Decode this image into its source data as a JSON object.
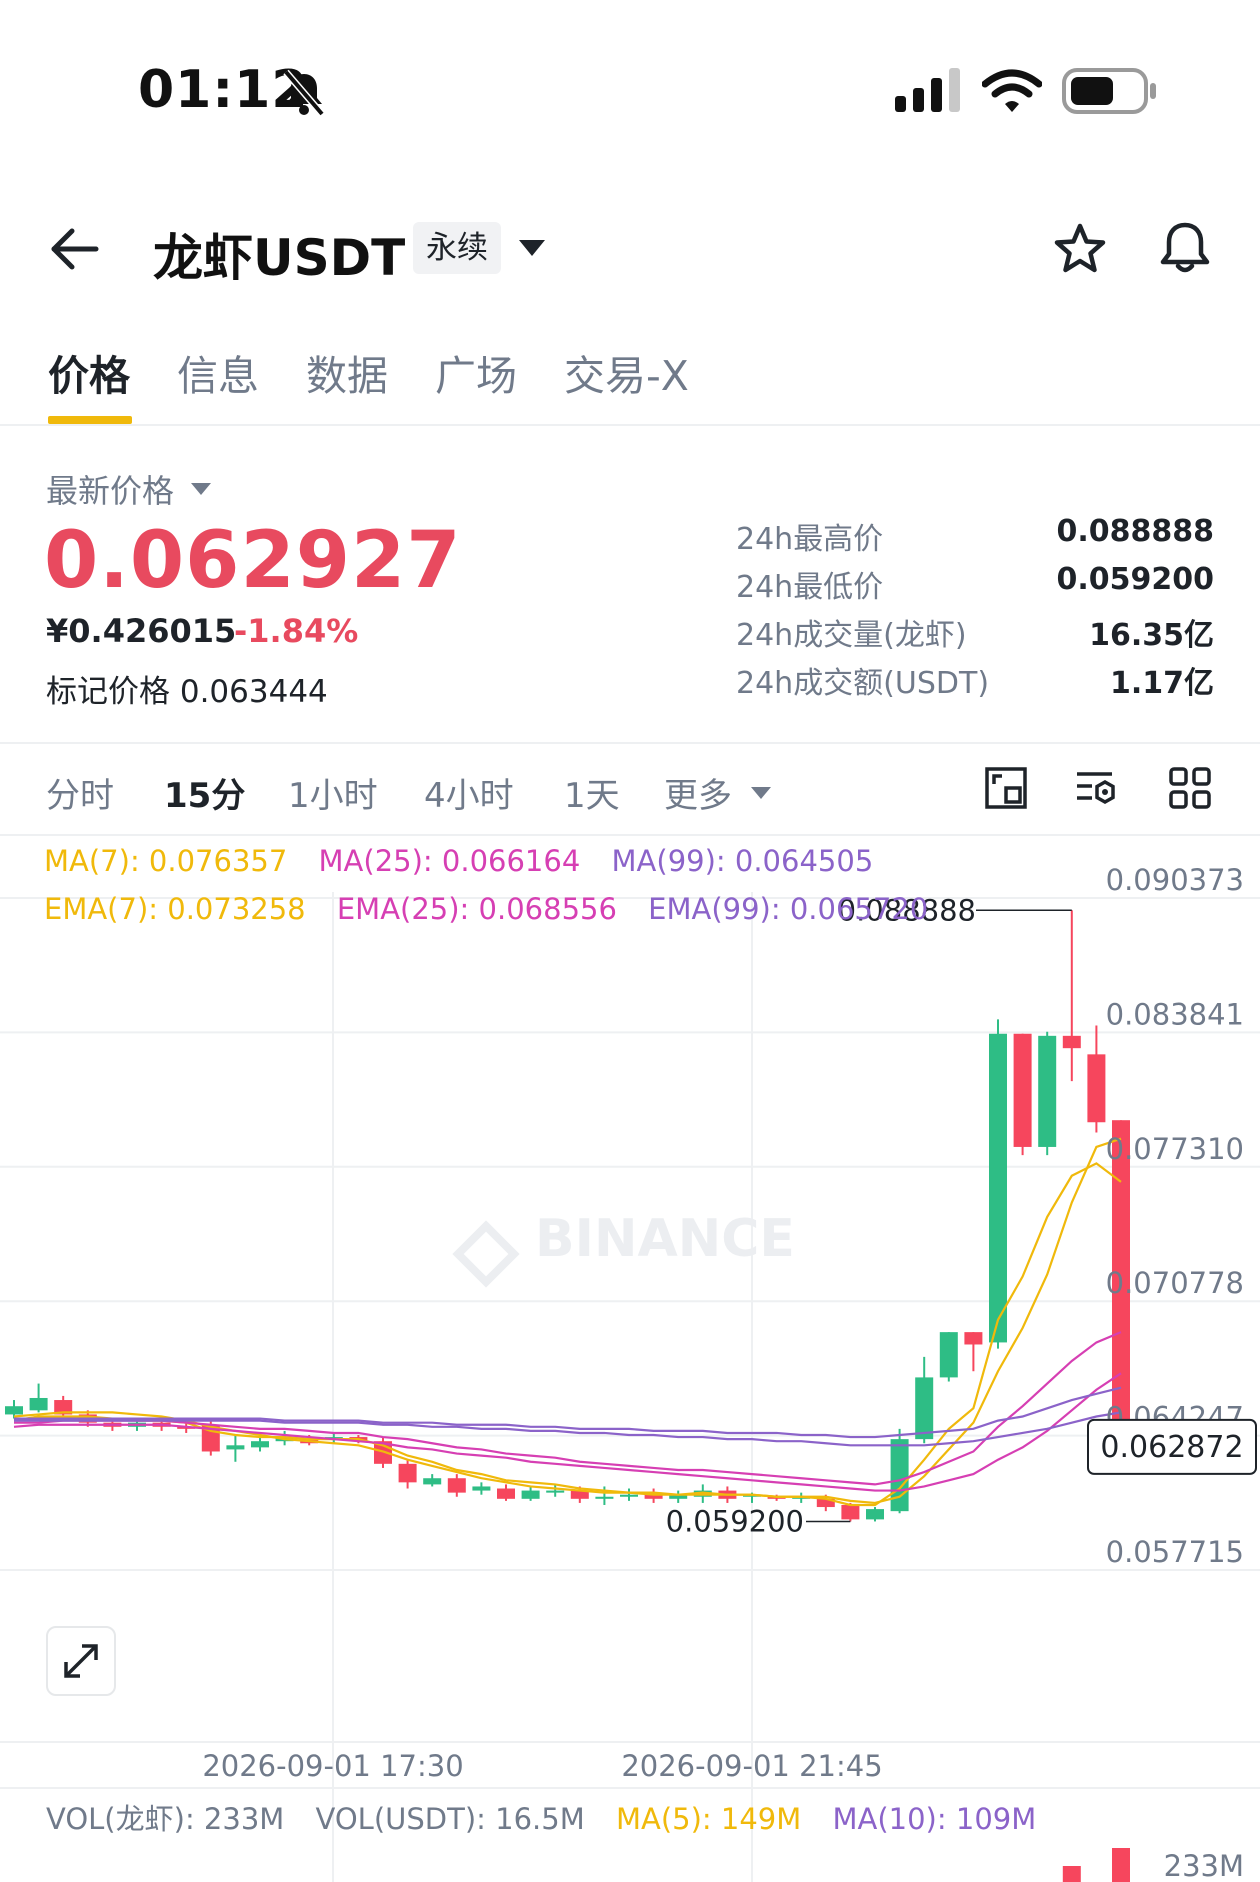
{
  "status_bar": {
    "time": "01:12",
    "icons": [
      "silent-bell-icon",
      "signal-icon",
      "wifi-icon",
      "battery-icon"
    ]
  },
  "header": {
    "pair": "龙虾USDT",
    "badge": "永续",
    "icons": [
      "back-arrow-icon",
      "dropdown-icon",
      "star-icon",
      "bell-icon"
    ]
  },
  "tabs": [
    "价格",
    "信息",
    "数据",
    "广场",
    "交易-X"
  ],
  "summary": {
    "latest_label": "最新价格",
    "last_price": "0.062927",
    "cny_price": "¥0.426015",
    "change_pct": "-1.84%",
    "mark_label": "标记价格",
    "mark_price": "0.063444",
    "stats": [
      {
        "label": "24h最高价",
        "value": "0.088888"
      },
      {
        "label": "24h最低价",
        "value": "0.059200"
      },
      {
        "label": "24h成交量(龙虾)",
        "value": "16.35亿"
      },
      {
        "label": "24h成交额(USDT)",
        "value": "1.17亿"
      }
    ]
  },
  "intervals": {
    "items": [
      "分时",
      "15分",
      "1小时",
      "4小时",
      "1天",
      "更多"
    ],
    "active": "15分"
  },
  "chart_tools": [
    "fullscreen-icon",
    "indicator-settings-icon",
    "grid-layout-icon"
  ],
  "indicators": {
    "ma7": "MA(7): 0.076357",
    "ma25": "MA(25): 0.066164",
    "ma99": "MA(99): 0.064505",
    "ema7": "EMA(7): 0.073258",
    "ema25": "EMA(25): 0.068556",
    "ema99": "EMA(99): 0.065720"
  },
  "volume": {
    "vol_coin": "VOL(龙虾): 233M",
    "vol_usdt": "VOL(USDT): 16.5M",
    "ma5": "MA(5): 149M",
    "ma10": "MA(10): 109M",
    "axis_top": "233M"
  },
  "colors": {
    "up": "#2ebd85",
    "down": "#f6465d",
    "ma7": "#f0b90b",
    "ma25": "#d63fb3",
    "ma99": "#8b63c9",
    "accent": "#f0b90b"
  },
  "watermark": "BINANCE",
  "chart_data": {
    "type": "candlestick",
    "price_axis": [
      "0.090373",
      "0.083841",
      "0.077310",
      "0.070778",
      "0.064247",
      "0.057715"
    ],
    "current_price_label": "0.062872",
    "high_label": "0.088888",
    "low_label": "0.059200",
    "x_ticks": [
      "2026-09-01 17:30",
      "2026-09-01 21:45"
    ],
    "ylim": [
      0.0572,
      0.0918
    ],
    "candles": [
      [
        0.0644,
        0.0648,
        0.0642,
        0.0651
      ],
      [
        0.0646,
        0.0652,
        0.0645,
        0.0659
      ],
      [
        0.0651,
        0.0644,
        0.0642,
        0.0653
      ],
      [
        0.0644,
        0.064,
        0.0638,
        0.0646
      ],
      [
        0.064,
        0.0638,
        0.0636,
        0.0642
      ],
      [
        0.0638,
        0.064,
        0.0636,
        0.0642
      ],
      [
        0.064,
        0.0638,
        0.0636,
        0.0642
      ],
      [
        0.0638,
        0.0637,
        0.0635,
        0.064
      ],
      [
        0.0639,
        0.0626,
        0.0624,
        0.0641
      ],
      [
        0.0627,
        0.0629,
        0.0621,
        0.0634
      ],
      [
        0.0628,
        0.0631,
        0.0626,
        0.0634
      ],
      [
        0.0631,
        0.0633,
        0.0629,
        0.0636
      ],
      [
        0.0632,
        0.063,
        0.0629,
        0.0634
      ],
      [
        0.0632,
        0.0633,
        0.063,
        0.0635
      ],
      [
        0.0633,
        0.0631,
        0.063,
        0.0634
      ],
      [
        0.0631,
        0.062,
        0.0618,
        0.0633
      ],
      [
        0.062,
        0.0611,
        0.0608,
        0.0622
      ],
      [
        0.061,
        0.0613,
        0.0609,
        0.0615
      ],
      [
        0.0613,
        0.0606,
        0.0604,
        0.0615
      ],
      [
        0.0607,
        0.0609,
        0.0605,
        0.0611
      ],
      [
        0.0608,
        0.0603,
        0.0602,
        0.061
      ],
      [
        0.0603,
        0.0607,
        0.0602,
        0.0609
      ],
      [
        0.0606,
        0.0607,
        0.0604,
        0.061
      ],
      [
        0.0607,
        0.0603,
        0.0601,
        0.0609
      ],
      [
        0.0603,
        0.0604,
        0.06,
        0.0609
      ],
      [
        0.0604,
        0.0605,
        0.0602,
        0.0608
      ],
      [
        0.0605,
        0.0603,
        0.0601,
        0.0608
      ],
      [
        0.0603,
        0.0605,
        0.0601,
        0.0607
      ],
      [
        0.0604,
        0.0607,
        0.0601,
        0.061
      ],
      [
        0.0607,
        0.0603,
        0.0601,
        0.0609
      ],
      [
        0.0604,
        0.0605,
        0.0601,
        0.0606
      ],
      [
        0.0604,
        0.0603,
        0.0602,
        0.0605
      ],
      [
        0.0603,
        0.0604,
        0.0601,
        0.0606
      ],
      [
        0.0603,
        0.0599,
        0.0597,
        0.0605
      ],
      [
        0.06,
        0.0593,
        0.0592,
        0.0601
      ],
      [
        0.0593,
        0.0598,
        0.0592,
        0.0599
      ],
      [
        0.0597,
        0.0632,
        0.0596,
        0.0637
      ],
      [
        0.0632,
        0.0662,
        0.063,
        0.0672
      ],
      [
        0.0662,
        0.0684,
        0.066,
        0.0684
      ],
      [
        0.0684,
        0.0678,
        0.0665,
        0.0684
      ],
      [
        0.0679,
        0.0829,
        0.0676,
        0.0836
      ],
      [
        0.0829,
        0.0774,
        0.077,
        0.0829
      ],
      [
        0.0774,
        0.0828,
        0.077,
        0.083
      ],
      [
        0.0828,
        0.0822,
        0.0806,
        0.0889
      ],
      [
        0.0819,
        0.0786,
        0.0781,
        0.0833
      ],
      [
        0.0787,
        0.0629,
        0.0626,
        0.0787
      ]
    ],
    "series": [
      {
        "name": "MA(7)",
        "color": "#f0b90b",
        "values": [
          0.0643,
          0.0644,
          0.0645,
          0.0645,
          0.0645,
          0.0644,
          0.0643,
          0.0641,
          0.0638,
          0.0636,
          0.0634,
          0.0632,
          0.0631,
          0.063,
          0.0629,
          0.0626,
          0.0622,
          0.0619,
          0.0616,
          0.0613,
          0.0611,
          0.0609,
          0.0608,
          0.0607,
          0.0606,
          0.0606,
          0.0605,
          0.0605,
          0.0605,
          0.0605,
          0.0605,
          0.0604,
          0.0604,
          0.0604,
          0.0602,
          0.0601,
          0.0604,
          0.0614,
          0.0627,
          0.064,
          0.0665,
          0.0686,
          0.0712,
          0.0747,
          0.0774,
          0.0778,
          0.0764
        ]
      },
      {
        "name": "EMA(7)",
        "color": "#f0b90b",
        "values": [
          0.0641,
          0.0643,
          0.0643,
          0.0643,
          0.0642,
          0.0641,
          0.0641,
          0.064,
          0.0636,
          0.0634,
          0.0633,
          0.0633,
          0.0632,
          0.0632,
          0.0632,
          0.0629,
          0.0624,
          0.0621,
          0.0617,
          0.0615,
          0.0612,
          0.0611,
          0.061,
          0.0608,
          0.0607,
          0.0606,
          0.0606,
          0.0605,
          0.0606,
          0.0605,
          0.0605,
          0.0604,
          0.0604,
          0.0603,
          0.06,
          0.06,
          0.0608,
          0.0622,
          0.0637,
          0.0647,
          0.069,
          0.0711,
          0.074,
          0.076,
          0.0766,
          0.0757,
          0.0733
        ]
      },
      {
        "name": "MA(25)",
        "color": "#d63fb3",
        "values": [
          0.0638,
          0.0639,
          0.0639,
          0.0639,
          0.0639,
          0.0639,
          0.0639,
          0.0638,
          0.0637,
          0.0636,
          0.0635,
          0.0634,
          0.0633,
          0.0632,
          0.0631,
          0.063,
          0.0628,
          0.0627,
          0.0625,
          0.0624,
          0.0623,
          0.0621,
          0.062,
          0.0619,
          0.0618,
          0.0617,
          0.0616,
          0.0615,
          0.0614,
          0.0613,
          0.0612,
          0.0611,
          0.061,
          0.0609,
          0.0608,
          0.0607,
          0.0607,
          0.0609,
          0.0612,
          0.0615,
          0.0622,
          0.0628,
          0.0636,
          0.0646,
          0.0656,
          0.0664,
          0.0662
        ]
      },
      {
        "name": "EMA(25)",
        "color": "#d63fb3",
        "values": [
          0.064,
          0.064,
          0.0641,
          0.0641,
          0.0641,
          0.0641,
          0.0641,
          0.064,
          0.0639,
          0.0638,
          0.0637,
          0.0637,
          0.0636,
          0.0635,
          0.0635,
          0.0633,
          0.0632,
          0.063,
          0.0628,
          0.0627,
          0.0625,
          0.0624,
          0.0623,
          0.0621,
          0.062,
          0.0619,
          0.0618,
          0.0617,
          0.0617,
          0.0616,
          0.0615,
          0.0614,
          0.0613,
          0.0612,
          0.0611,
          0.061,
          0.0612,
          0.0616,
          0.0621,
          0.0626,
          0.0638,
          0.0648,
          0.0659,
          0.067,
          0.0679,
          0.0684,
          0.0686
        ]
      },
      {
        "name": "MA(99)",
        "color": "#8b63c9",
        "values": [
          0.0641,
          0.0641,
          0.0641,
          0.0641,
          0.0641,
          0.0641,
          0.0641,
          0.0641,
          0.0641,
          0.0641,
          0.0641,
          0.064,
          0.064,
          0.064,
          0.064,
          0.0639,
          0.0639,
          0.0638,
          0.0638,
          0.0637,
          0.0637,
          0.0636,
          0.0636,
          0.0635,
          0.0635,
          0.0634,
          0.0634,
          0.0633,
          0.0633,
          0.0632,
          0.0632,
          0.0631,
          0.0631,
          0.063,
          0.0629,
          0.0629,
          0.0629,
          0.0629,
          0.063,
          0.0631,
          0.0633,
          0.0635,
          0.0637,
          0.064,
          0.0643,
          0.0645,
          0.0645
        ]
      },
      {
        "name": "EMA(99)",
        "color": "#8b63c9",
        "values": [
          0.0642,
          0.0642,
          0.0642,
          0.0642,
          0.0642,
          0.0642,
          0.0642,
          0.0642,
          0.0642,
          0.0642,
          0.0642,
          0.0641,
          0.0641,
          0.0641,
          0.0641,
          0.064,
          0.064,
          0.064,
          0.0639,
          0.0639,
          0.0639,
          0.0638,
          0.0638,
          0.0637,
          0.0637,
          0.0637,
          0.0636,
          0.0636,
          0.0636,
          0.0635,
          0.0635,
          0.0635,
          0.0634,
          0.0634,
          0.0633,
          0.0633,
          0.0634,
          0.0635,
          0.0636,
          0.0637,
          0.0641,
          0.0643,
          0.0647,
          0.0651,
          0.0654,
          0.0657,
          0.0657
        ]
      }
    ]
  }
}
